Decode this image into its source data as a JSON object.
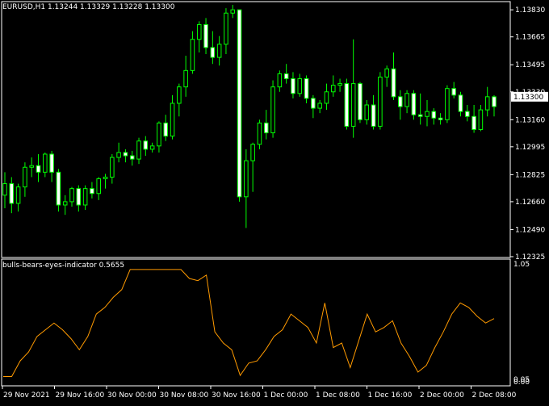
{
  "main_panel": {
    "title": "EURUSD,H1  1.13244 1.13329 1.13228 1.13300",
    "price_ticks": [
      "1.13830",
      "1.13665",
      "1.13495",
      "1.13330",
      "1.13160",
      "1.12995",
      "1.12825",
      "1.12660",
      "1.12490",
      "1.12325"
    ],
    "current_price": "1.13300"
  },
  "sub_panel": {
    "title": "bulls-bears-eyes-indicator 0.5655",
    "top_tick": "1.05",
    "bottom_ticks": [
      "0.05",
      "0.00"
    ]
  },
  "time_axis": [
    "29 Nov 2021",
    "29 Nov 16:00",
    "30 Nov 00:00",
    "30 Nov 08:00",
    "30 Nov 16:00",
    "1 Dec 00:00",
    "1 Dec 08:00",
    "1 Dec 16:00",
    "2 Dec 00:00",
    "2 Dec 08:00"
  ],
  "chart_data": [
    {
      "type": "candlestick",
      "title": "EURUSD,H1",
      "ohlc_current": {
        "open": 1.13244,
        "high": 1.13329,
        "low": 1.13228,
        "close": 1.133
      },
      "ylim": [
        1.1232,
        1.1388
      ],
      "candles": [
        [
          1.127,
          1.1284,
          1.1262,
          1.1277
        ],
        [
          1.1277,
          1.1281,
          1.1259,
          1.1265
        ],
        [
          1.1265,
          1.1277,
          1.126,
          1.1275
        ],
        [
          1.1275,
          1.129,
          1.1269,
          1.1287
        ],
        [
          1.1287,
          1.1293,
          1.1281,
          1.1288
        ],
        [
          1.1288,
          1.1295,
          1.1278,
          1.1284
        ],
        [
          1.1284,
          1.1296,
          1.1281,
          1.1295
        ],
        [
          1.1295,
          1.1297,
          1.1278,
          1.1284
        ],
        [
          1.1284,
          1.1286,
          1.126,
          1.1264
        ],
        [
          1.1264,
          1.127,
          1.1258,
          1.1266
        ],
        [
          1.1266,
          1.1275,
          1.1263,
          1.1274
        ],
        [
          1.1274,
          1.1276,
          1.126,
          1.1264
        ],
        [
          1.1264,
          1.1276,
          1.1261,
          1.1274
        ],
        [
          1.1274,
          1.1278,
          1.1268,
          1.1271
        ],
        [
          1.1271,
          1.1281,
          1.1267,
          1.128
        ],
        [
          1.128,
          1.1283,
          1.1274,
          1.1281
        ],
        [
          1.1281,
          1.1295,
          1.1277,
          1.1293
        ],
        [
          1.1293,
          1.1302,
          1.129,
          1.1296
        ],
        [
          1.1296,
          1.1298,
          1.129,
          1.1294
        ],
        [
          1.1294,
          1.1297,
          1.1288,
          1.1292
        ],
        [
          1.1292,
          1.1305,
          1.1289,
          1.1303
        ],
        [
          1.1303,
          1.1306,
          1.1294,
          1.1298
        ],
        [
          1.1298,
          1.1302,
          1.1296,
          1.13
        ],
        [
          1.13,
          1.1315,
          1.1296,
          1.1314
        ],
        [
          1.1314,
          1.1319,
          1.1303,
          1.1306
        ],
        [
          1.1306,
          1.1331,
          1.1304,
          1.1326
        ],
        [
          1.1326,
          1.1338,
          1.1318,
          1.1336
        ],
        [
          1.1336,
          1.1355,
          1.133,
          1.1346
        ],
        [
          1.1346,
          1.137,
          1.1344,
          1.1365
        ],
        [
          1.1365,
          1.1376,
          1.1357,
          1.1374
        ],
        [
          1.1374,
          1.1378,
          1.1356,
          1.136
        ],
        [
          1.136,
          1.137,
          1.135,
          1.1354
        ],
        [
          1.1354,
          1.1367,
          1.1349,
          1.1362
        ],
        [
          1.1362,
          1.1384,
          1.1356,
          1.1381
        ],
        [
          1.1381,
          1.1386,
          1.1378,
          1.1383
        ],
        [
          1.1383,
          1.1383,
          1.1266,
          1.1269
        ],
        [
          1.1269,
          1.1298,
          1.125,
          1.1291
        ],
        [
          1.1291,
          1.1302,
          1.1272,
          1.1301
        ],
        [
          1.1301,
          1.1316,
          1.1298,
          1.1314
        ],
        [
          1.1314,
          1.1322,
          1.1304,
          1.1308
        ],
        [
          1.1308,
          1.134,
          1.1305,
          1.1336
        ],
        [
          1.1336,
          1.1346,
          1.1333,
          1.1344
        ],
        [
          1.1344,
          1.135,
          1.1338,
          1.1341
        ],
        [
          1.1341,
          1.1345,
          1.1329,
          1.1332
        ],
        [
          1.1332,
          1.1344,
          1.133,
          1.1341
        ],
        [
          1.1341,
          1.1343,
          1.1326,
          1.1329
        ],
        [
          1.1329,
          1.1331,
          1.1317,
          1.1323
        ],
        [
          1.1323,
          1.1328,
          1.132,
          1.1326
        ],
        [
          1.1326,
          1.1338,
          1.1322,
          1.1333
        ],
        [
          1.1333,
          1.1343,
          1.133,
          1.1337
        ],
        [
          1.1337,
          1.1341,
          1.1333,
          1.1338
        ],
        [
          1.1338,
          1.1341,
          1.131,
          1.1312
        ],
        [
          1.1312,
          1.1365,
          1.1305,
          1.1338
        ],
        [
          1.1338,
          1.1339,
          1.1314,
          1.1316
        ],
        [
          1.1316,
          1.1328,
          1.1313,
          1.1325
        ],
        [
          1.1325,
          1.1331,
          1.131,
          1.1312
        ],
        [
          1.1312,
          1.1345,
          1.131,
          1.1342
        ],
        [
          1.1342,
          1.1349,
          1.1336,
          1.1347
        ],
        [
          1.1347,
          1.1357,
          1.1328,
          1.133
        ],
        [
          1.133,
          1.1334,
          1.1316,
          1.1324
        ],
        [
          1.1324,
          1.1334,
          1.132,
          1.1332
        ],
        [
          1.1332,
          1.1334,
          1.1316,
          1.1319
        ],
        [
          1.1319,
          1.1332,
          1.1313,
          1.1318
        ],
        [
          1.1318,
          1.1328,
          1.1312,
          1.1321
        ],
        [
          1.1321,
          1.1323,
          1.1313,
          1.1317
        ],
        [
          1.1317,
          1.132,
          1.1313,
          1.1316
        ],
        [
          1.1316,
          1.1337,
          1.1314,
          1.1335
        ],
        [
          1.1335,
          1.1339,
          1.1329,
          1.1331
        ],
        [
          1.1331,
          1.1333,
          1.1318,
          1.1321
        ],
        [
          1.1321,
          1.1325,
          1.1315,
          1.1318
        ],
        [
          1.1318,
          1.1325,
          1.1308,
          1.131
        ],
        [
          1.131,
          1.1325,
          1.1309,
          1.1322
        ],
        [
          1.1322,
          1.1336,
          1.1318,
          1.133
        ],
        [
          1.133,
          1.1331,
          1.1318,
          1.1324
        ]
      ]
    },
    {
      "type": "line",
      "title": "bulls-bears-eyes-indicator 0.5655",
      "ylim": [
        0.0,
        1.05
      ],
      "color": "#ff9a00",
      "values": [
        0.04,
        0.04,
        0.18,
        0.26,
        0.4,
        0.46,
        0.52,
        0.46,
        0.38,
        0.28,
        0.4,
        0.6,
        0.66,
        0.75,
        0.82,
        1.0,
        1.0,
        1.0,
        1.0,
        1.0,
        1.0,
        1.0,
        0.92,
        0.9,
        0.95,
        0.44,
        0.34,
        0.28,
        0.05,
        0.16,
        0.18,
        0.28,
        0.4,
        0.46,
        0.6,
        0.54,
        0.48,
        0.34,
        0.7,
        0.3,
        0.34,
        0.12,
        0.36,
        0.6,
        0.44,
        0.48,
        0.54,
        0.34,
        0.22,
        0.08,
        0.14,
        0.3,
        0.44,
        0.6,
        0.7,
        0.66,
        0.58,
        0.52,
        0.56
      ]
    }
  ],
  "colors": {
    "background": "#000000",
    "axis": "#ffffff",
    "candle_up": "#00ff00",
    "candle_down_fill": "#000000",
    "candle_bull_fill": "#ffffff",
    "indicator": "#ff9a00"
  }
}
